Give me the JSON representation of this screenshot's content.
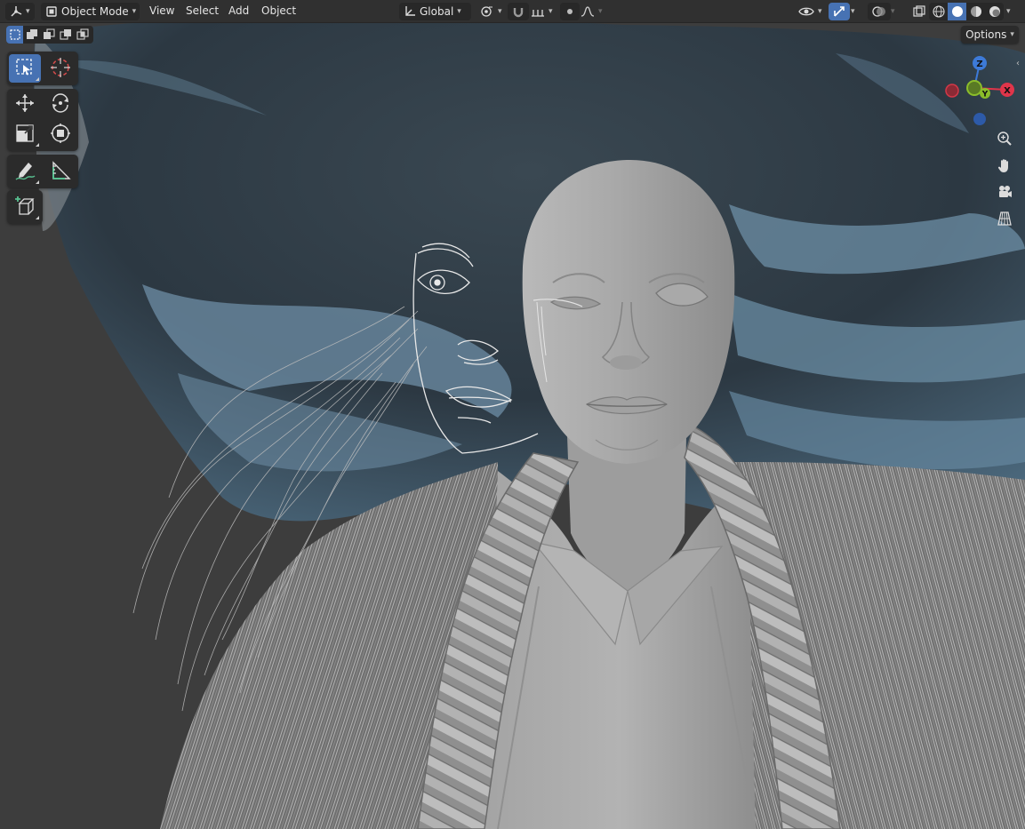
{
  "header": {
    "editor_type_icon": "view3d-icon",
    "mode": {
      "icon": "object-mode-icon",
      "label": "Object Mode"
    },
    "menus": [
      "View",
      "Select",
      "Add",
      "Object"
    ],
    "transform_orientation": {
      "icon": "orientation-global-icon",
      "label": "Global"
    },
    "pivot_icon": "pivot-median-icon",
    "snap": {
      "magnet_icon": "magnet-icon",
      "increment_icon": "snap-increment-icon"
    },
    "proportional": {
      "icon": "proportional-edit-icon",
      "falloff_icon": "falloff-smooth-icon"
    },
    "visibility_icon": "eye-icon",
    "gizmo_icon": "gizmo-icon",
    "overlay_icon": "overlay-icon",
    "xray_icon": "xray-icon",
    "shading_modes": [
      "wireframe-icon",
      "solid-icon",
      "material-preview-icon",
      "rendered-icon"
    ],
    "active_shading": "solid-icon"
  },
  "toolbar": {
    "select_modes": [
      "select-new-icon",
      "select-extend-icon",
      "select-subtract-icon",
      "select-invert-icon",
      "select-intersect-icon"
    ],
    "tools": [
      {
        "name": "select-box-icon",
        "active": true
      },
      {
        "name": "cursor-icon",
        "active": false
      },
      {
        "name": "move-icon",
        "active": false
      },
      {
        "name": "rotate-icon",
        "active": false
      },
      {
        "name": "scale-icon",
        "active": false
      },
      {
        "name": "transform-icon",
        "active": false
      },
      {
        "name": "annotate-icon",
        "active": false
      },
      {
        "name": "measure-icon",
        "active": false
      },
      {
        "name": "add-cube-icon",
        "active": false
      }
    ]
  },
  "options": {
    "label": "Options"
  },
  "navigation": {
    "axes": {
      "z": "Z",
      "y": "Y",
      "x": "X"
    },
    "axis_colors": {
      "x": "#e0354a",
      "y": "#8bbd2a",
      "z": "#3d7ad8"
    },
    "buttons": [
      "zoom-icon",
      "pan-hand-icon",
      "camera-icon",
      "ortho-grid-icon"
    ]
  },
  "colors": {
    "header_bg": "#303030",
    "accent": "#4772b3",
    "viewport_bg": "#3d3d3d"
  }
}
